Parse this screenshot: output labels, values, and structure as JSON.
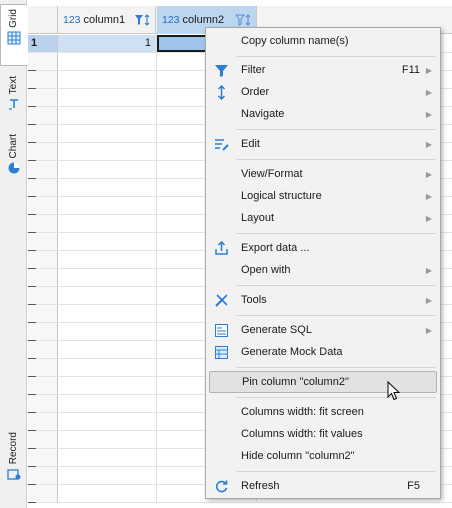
{
  "vtabs": {
    "grid": "Grid",
    "text": "Text",
    "chart": "Chart",
    "record": "Record"
  },
  "grid": {
    "columns": [
      {
        "type_tag": "123",
        "name": "column1"
      },
      {
        "type_tag": "123",
        "name": "column2"
      }
    ],
    "rows": [
      {
        "row_number": "1",
        "column1": "1",
        "column2": ""
      }
    ]
  },
  "context_menu": {
    "items": {
      "copy_column_names": {
        "label": "Copy column name(s)"
      },
      "filter": {
        "label": "Filter",
        "shortcut": "F11",
        "icon": "filter-icon",
        "submenu": true
      },
      "order": {
        "label": "Order",
        "icon": "sort-icon",
        "submenu": true
      },
      "navigate": {
        "label": "Navigate",
        "submenu": true
      },
      "edit": {
        "label": "Edit",
        "icon": "edit-icon",
        "submenu": true
      },
      "view_format": {
        "label": "View/Format",
        "submenu": true
      },
      "logical_structure": {
        "label": "Logical structure",
        "submenu": true
      },
      "layout": {
        "label": "Layout",
        "submenu": true
      },
      "export_data": {
        "label": "Export data ...",
        "icon": "export-icon"
      },
      "open_with": {
        "label": "Open with",
        "submenu": true
      },
      "tools": {
        "label": "Tools",
        "icon": "tools-icon",
        "submenu": true
      },
      "generate_sql": {
        "label": "Generate SQL",
        "icon": "sql-icon",
        "submenu": true
      },
      "generate_mock_data": {
        "label": "Generate Mock Data",
        "icon": "mock-data-icon"
      },
      "pin_column": {
        "label": "Pin column \"column2\"",
        "highlighted": true
      },
      "fit_screen": {
        "label": "Columns width: fit screen"
      },
      "fit_values": {
        "label": "Columns width: fit values"
      },
      "hide_column": {
        "label": "Hide column \"column2\""
      },
      "refresh": {
        "label": "Refresh",
        "shortcut": "F5",
        "icon": "refresh-icon"
      }
    }
  },
  "colors": {
    "accent": "#1f6fc0",
    "selected_header": "#bcd6f0",
    "menu_bg": "#f2f2f2",
    "menu_highlight": "#e2e2e2"
  }
}
